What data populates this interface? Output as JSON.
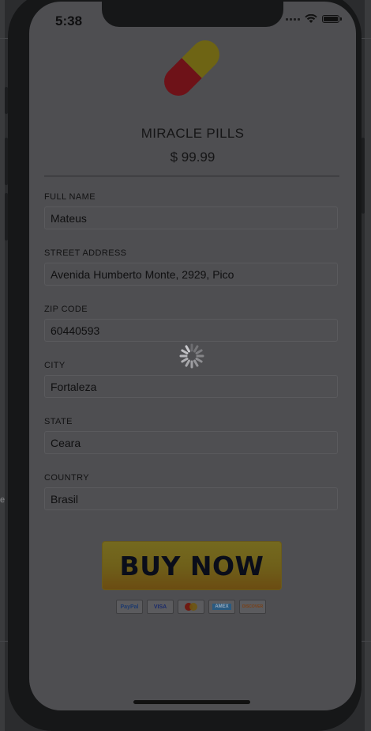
{
  "status_bar": {
    "time": "5:38"
  },
  "product": {
    "name": "MIRACLE PILLS",
    "price": "$ 99.99"
  },
  "form": {
    "fields": [
      {
        "label": "FULL NAME",
        "value": "Mateus"
      },
      {
        "label": "STREET ADDRESS",
        "value": "Avenida Humberto Monte, 2929, Pico"
      },
      {
        "label": "ZIP CODE",
        "value": "60440593"
      },
      {
        "label": "CITY",
        "value": "Fortaleza"
      },
      {
        "label": "STATE",
        "value": "Ceara"
      },
      {
        "label": "COUNTRY",
        "value": "Brasil"
      }
    ]
  },
  "buy_button": {
    "label": "BUY NOW"
  },
  "payment_methods": [
    {
      "label": "PayPal",
      "color": "#1d3a6e"
    },
    {
      "label": "VISA",
      "color": "#1a2a6a"
    },
    {
      "label": "mastercard-icon",
      "color": "#7a2a1a"
    },
    {
      "label": "AMEX",
      "color": "#1f4f78"
    },
    {
      "label": "DISCOVER",
      "color": "#7a4015"
    }
  ],
  "background": {
    "glyph": "e"
  },
  "colors": {
    "overlay": "#4e4e51",
    "pill_red": "#6e1218",
    "pill_yellow": "#6e6414"
  }
}
